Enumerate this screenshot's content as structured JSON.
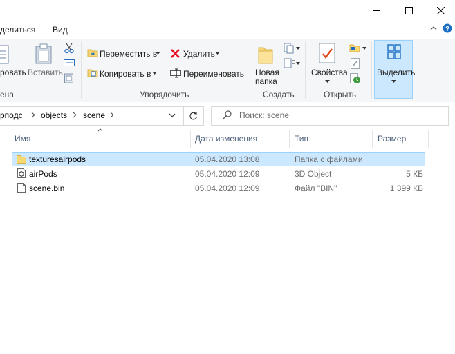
{
  "window": {
    "minimize_icon": "minimize-icon",
    "maximize_icon": "maximize-icon",
    "close_icon": "close-icon"
  },
  "menu": {
    "items": [
      "делиться",
      "Вид"
    ]
  },
  "ribbon": {
    "clipboard": {
      "copy_path_label": "ровать",
      "paste_label": "Вставить",
      "group_label": "ена"
    },
    "organize": {
      "move_label": "Переместить в",
      "copy_label": "Копировать в",
      "delete_label": "Удалить",
      "rename_label": "Переименовать",
      "group_label": "Упорядочить"
    },
    "new": {
      "new_folder_label_1": "Новая",
      "new_folder_label_2": "папка",
      "group_label": "Создать"
    },
    "open": {
      "properties_label": "Свойства",
      "group_label": "Открыть"
    },
    "select": {
      "select_label": "Выделить"
    },
    "colors": {
      "accent": "#cce8ff",
      "delete_red": "#e81123",
      "folder_yellow": "#f8d775"
    }
  },
  "address": {
    "crumbs": [
      "рподс",
      "objects",
      "scene"
    ]
  },
  "search": {
    "placeholder": "Поиск: scene"
  },
  "columns": {
    "name": "Имя",
    "date": "Дата изменения",
    "type": "Тип",
    "size": "Размер"
  },
  "files": [
    {
      "name": "texturesairpods",
      "date": "05.04.2020 13:08",
      "type": "Папка с файлами",
      "size": "",
      "icon": "folder-icon",
      "selected": true
    },
    {
      "name": "airPods",
      "date": "05.04.2020 12:09",
      "type": "3D Object",
      "size": "5 КБ",
      "icon": "3d-object-icon",
      "selected": false
    },
    {
      "name": "scene.bin",
      "date": "05.04.2020 12:09",
      "type": "Файл \"BIN\"",
      "size": "1 399 КБ",
      "icon": "file-icon",
      "selected": false
    }
  ]
}
